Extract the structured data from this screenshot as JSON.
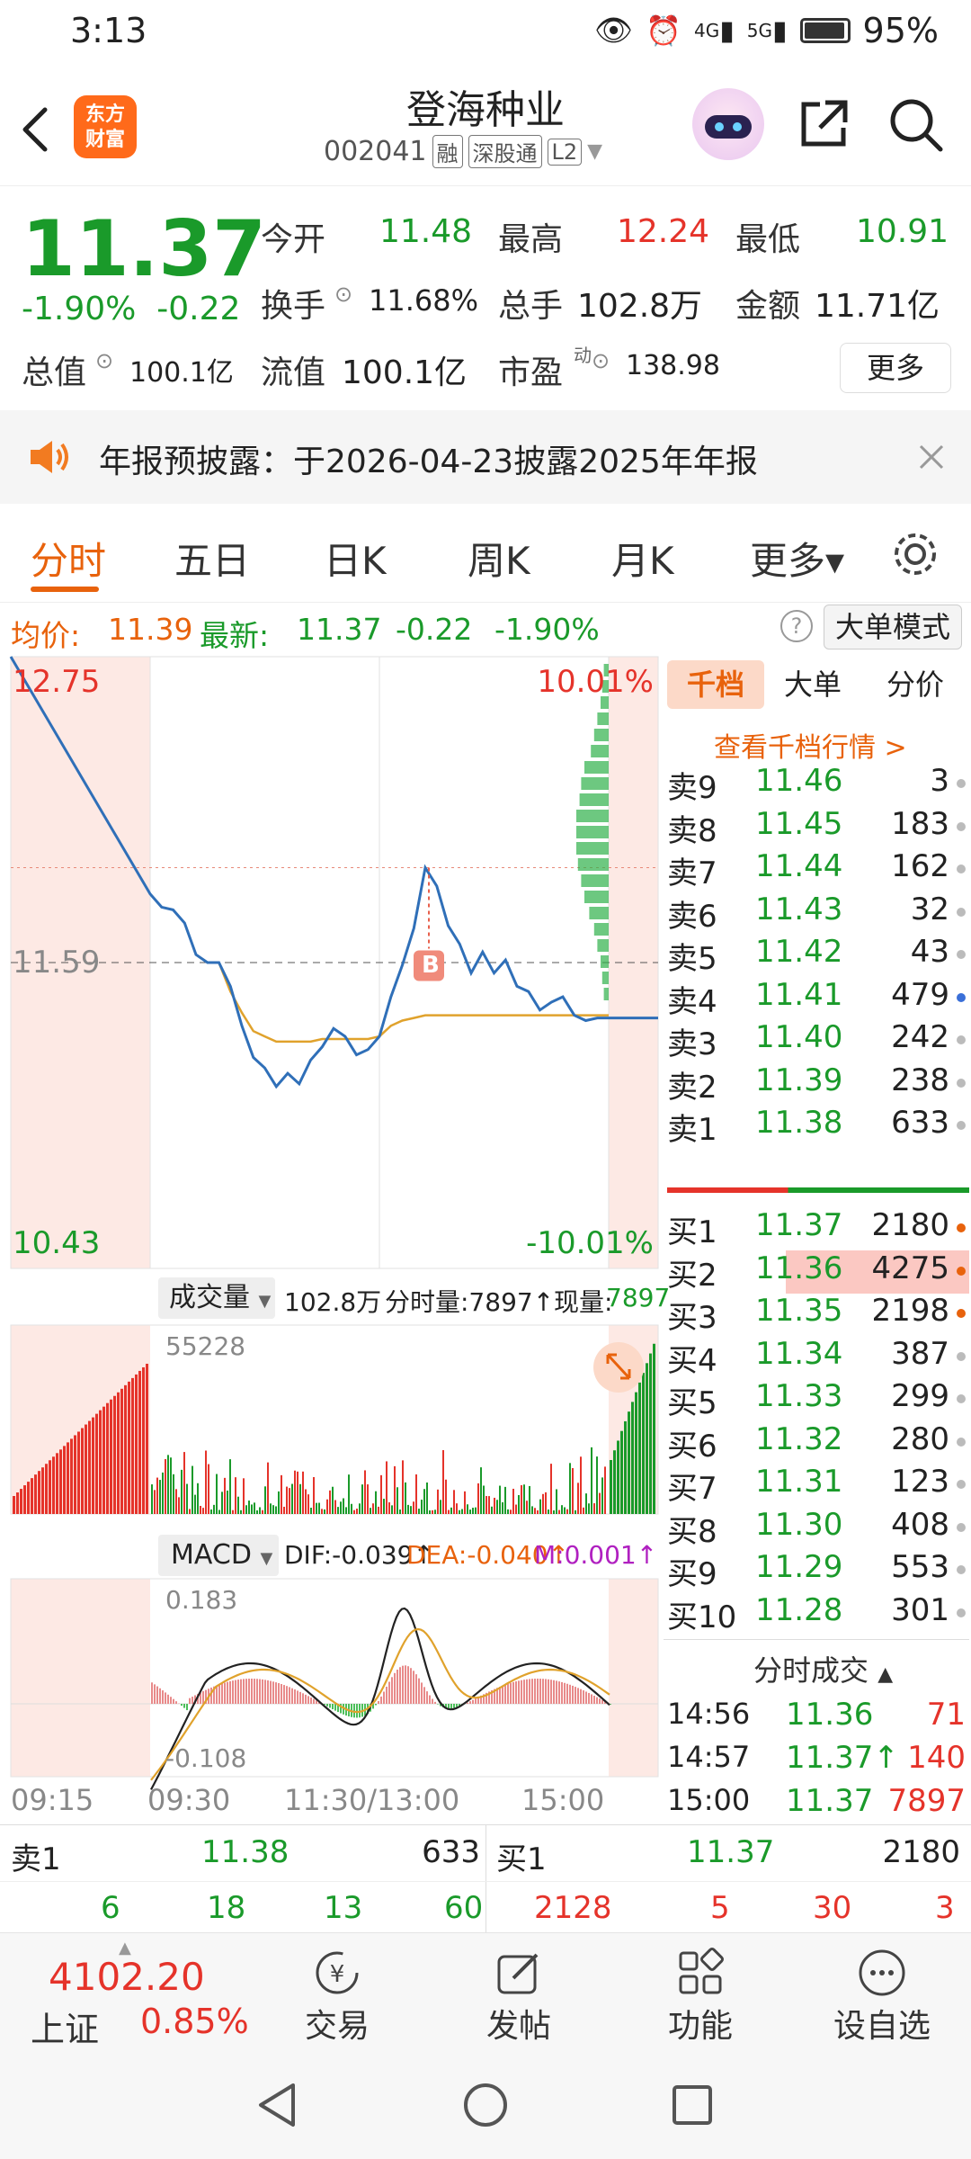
{
  "status_bar": {
    "time": "3:13",
    "net1": "4G",
    "net2": "5G",
    "battery": "95%"
  },
  "header": {
    "logo_line1": "东方",
    "logo_line2": "财富",
    "stock_name": "登海种业",
    "stock_code": "002041",
    "tags": [
      "融",
      "深股通",
      "L2"
    ]
  },
  "quote": {
    "price": "11.37",
    "change_pct": "-1.90%",
    "change_amt": "-0.22",
    "open_label": "今开",
    "open": "11.48",
    "high_label": "最高",
    "high": "12.24",
    "low_label": "最低",
    "low": "10.91",
    "turnover_label": "换手",
    "turnover": "11.68%",
    "volume_label": "总手",
    "volume": "102.8万",
    "amount_label": "金额",
    "amount": "11.71亿",
    "mktcap_label": "总值",
    "mktcap": "100.1亿",
    "float_label": "流值",
    "float": "100.1亿",
    "pe_label": "市盈",
    "pe_sup": "动",
    "pe": "138.98",
    "more": "更多"
  },
  "notice": {
    "text": "年报预披露：于2026-04-23披露2025年年报"
  },
  "tabs": [
    "分时",
    "五日",
    "日K",
    "周K",
    "月K",
    "更多▾"
  ],
  "inforow": {
    "avg_label": "均价:",
    "avg": "11.39",
    "latest_label": "最新:",
    "latest": "11.37",
    "chg": "-0.22",
    "pct": "-1.90%",
    "mode_button": "大单模式"
  },
  "chart": {
    "top_price": "12.75",
    "mid_price": "11.59",
    "bottom_price": "10.43",
    "top_pct": "10.01%",
    "bottom_pct": "-10.01%",
    "marker": "B",
    "vol_selector": "成交量",
    "vol_total": "102.8万",
    "vol_tick_label": "分时量:7897↑",
    "vol_now_label": "现量:",
    "vol_now": "7897",
    "vol_max": "55228",
    "macd_selector": "MACD",
    "dif": "DIF:-0.039↑",
    "dea": "DEA:-0.040↑",
    "m": "M:0.001↑",
    "macd_top": "0.183",
    "macd_bottom": "-0.108",
    "x_labels": [
      "09:15",
      "09:30",
      "11:30/13:00",
      "15:00"
    ]
  },
  "chart_data": {
    "type": "line",
    "title": "",
    "ylim": [
      10.43,
      12.75
    ],
    "prev_close": 11.59,
    "series": [
      {
        "name": "最新",
        "values": [
          12.75,
          11.85,
          11.8,
          11.79,
          11.74,
          11.62,
          11.59,
          11.59,
          11.5,
          11.35,
          11.23,
          11.19,
          11.12,
          11.17,
          11.13,
          11.22,
          11.27,
          11.34,
          11.31,
          11.24,
          11.26,
          11.31,
          11.46,
          11.58,
          11.72,
          11.95,
          11.88,
          11.73,
          11.66,
          11.55,
          11.63,
          11.55,
          11.6,
          11.5,
          11.48,
          11.41,
          11.44,
          11.46,
          11.39,
          11.37,
          11.38,
          11.38
        ]
      },
      {
        "name": "均价",
        "values": [
          11.59,
          11.59,
          11.59,
          11.59,
          11.59,
          11.59,
          11.59,
          11.59,
          11.48,
          11.4,
          11.33,
          11.31,
          11.29,
          11.29,
          11.29,
          11.29,
          11.3,
          11.3,
          11.3,
          11.3,
          11.3,
          11.31,
          11.35,
          11.37,
          11.38,
          11.39,
          11.39,
          11.39,
          11.39,
          11.39,
          11.39,
          11.39,
          11.39,
          11.39,
          11.39,
          11.39,
          11.39,
          11.39,
          11.39,
          11.39,
          11.39,
          11.39
        ]
      }
    ]
  },
  "book": {
    "tabs": [
      "千档",
      "大单",
      "分价"
    ],
    "link": "查看千档行情 >",
    "asks": [
      {
        "label": "卖9",
        "price": "11.46",
        "vol": "3"
      },
      {
        "label": "卖8",
        "price": "11.45",
        "vol": "183"
      },
      {
        "label": "卖7",
        "price": "11.44",
        "vol": "162"
      },
      {
        "label": "卖6",
        "price": "11.43",
        "vol": "32"
      },
      {
        "label": "卖5",
        "price": "11.42",
        "vol": "43"
      },
      {
        "label": "卖4",
        "price": "11.41",
        "vol": "479"
      },
      {
        "label": "卖3",
        "price": "11.40",
        "vol": "242"
      },
      {
        "label": "卖2",
        "price": "11.39",
        "vol": "238"
      },
      {
        "label": "卖1",
        "price": "11.38",
        "vol": "633"
      }
    ],
    "bids": [
      {
        "label": "买1",
        "price": "11.37",
        "vol": "2180"
      },
      {
        "label": "买2",
        "price": "11.36",
        "vol": "4275"
      },
      {
        "label": "买3",
        "price": "11.35",
        "vol": "2198"
      },
      {
        "label": "买4",
        "price": "11.34",
        "vol": "387"
      },
      {
        "label": "买5",
        "price": "11.33",
        "vol": "299"
      },
      {
        "label": "买6",
        "price": "11.32",
        "vol": "280"
      },
      {
        "label": "买7",
        "price": "11.31",
        "vol": "123"
      },
      {
        "label": "买8",
        "price": "11.30",
        "vol": "408"
      },
      {
        "label": "买9",
        "price": "11.29",
        "vol": "553"
      },
      {
        "label": "买10",
        "price": "11.28",
        "vol": "301"
      }
    ],
    "ticks_title": "分时成交",
    "ticks": [
      {
        "time": "14:56",
        "price": "11.36",
        "vol": "71"
      },
      {
        "time": "14:57",
        "price": "11.37↑",
        "vol": "140"
      },
      {
        "time": "15:00",
        "price": "11.37",
        "vol": "7897"
      }
    ]
  },
  "bottom_quote": {
    "ask_label": "卖1",
    "ask_price": "11.38",
    "ask_vol": "633",
    "bid_label": "买1",
    "bid_price": "11.37",
    "bid_vol": "2180",
    "ask_queue": [
      "6",
      "18",
      "13",
      "60"
    ],
    "bid_queue": [
      "2128",
      "5",
      "30",
      "3"
    ]
  },
  "footer": {
    "index_value": "4102.20",
    "index_name": "上证",
    "index_pct": "0.85%",
    "items": [
      "交易",
      "发帖",
      "功能",
      "设自选"
    ]
  }
}
